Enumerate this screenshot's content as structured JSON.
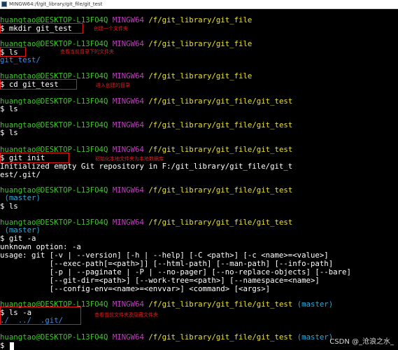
{
  "window": {
    "title": "MINGW64:/f/git_library/git_file/git_test"
  },
  "prompt": {
    "user_host": "huangtao@DESKTOP-L13FO4Q",
    "env": "MINGW64",
    "path_git_file": "/f/git_library/git_file",
    "path_git_test": "/f/git_library/git_file/git_test",
    "branch": "(master)"
  },
  "commands": {
    "mkdir": "$ mkdir git_test",
    "ls1": "$ ls",
    "cd": "$ cd git_test",
    "ls2": "$ ls",
    "ls3": "$ ls",
    "git_init": "$ git init",
    "ls4": "$ ls",
    "git_a": "$ git -a",
    "ls_a": "$ ls -a",
    "empty": "$"
  },
  "outputs": {
    "ls1_result": "git_test/",
    "init_1": "Initialized empty Git repository in F:/git_library/git_file/git_t",
    "init_2": "est/.git/",
    "unknown": "unknown option: -a",
    "usage": [
      "usage: git [-v | --version] [-h | --help] [-C <path>] [-c <name>=<value>]",
      "           [--exec-path[=<path>]] [--html-path] [--man-path] [--info-path]",
      "           [-p | --paginate | -P | --no-pager] [--no-replace-objects] [--bare]",
      "           [--git-dir=<path>] [--work-tree=<path>] [--namespace=<name>]",
      "           [--config-env=<name>=<envvar>] <command> [<args>]"
    ],
    "ls_a_dots": "./  ../  ",
    "ls_a_git": ".git/"
  },
  "annotations": {
    "mkdir": "创建一个文件夹",
    "ls": "查看当前目录下的文件夹",
    "cd": "进入创建的目录",
    "git_init": "初始化本地文件夹为本地数据库",
    "ls_a": "查看当前文件夹及隐藏文件夹"
  },
  "watermark": "CSDN @_沧浪之水_",
  "colors": {
    "background": "#000000",
    "user_host": "#3fc62b",
    "env": "#bf3fbf",
    "path": "#e8e02a",
    "branch": "#2aa9d6",
    "directory": "#3b8eea",
    "highlight": "#e01414"
  }
}
